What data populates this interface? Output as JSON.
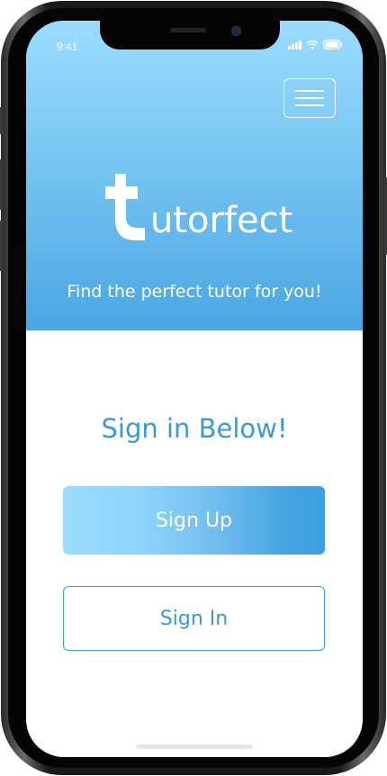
{
  "status_bar": {
    "time": "9:41"
  },
  "header": {
    "menu_icon": "hamburger-menu-icon",
    "logo_text": "utorfect",
    "tagline": "Find the perfect tutor for you!"
  },
  "main": {
    "heading": "Sign in Below!",
    "sign_up_label": "Sign Up",
    "sign_in_label": "Sign In"
  },
  "colors": {
    "accent": "#3a9ad9",
    "hero_top": "#9bdcff",
    "hero_bottom": "#4aa6e2"
  }
}
